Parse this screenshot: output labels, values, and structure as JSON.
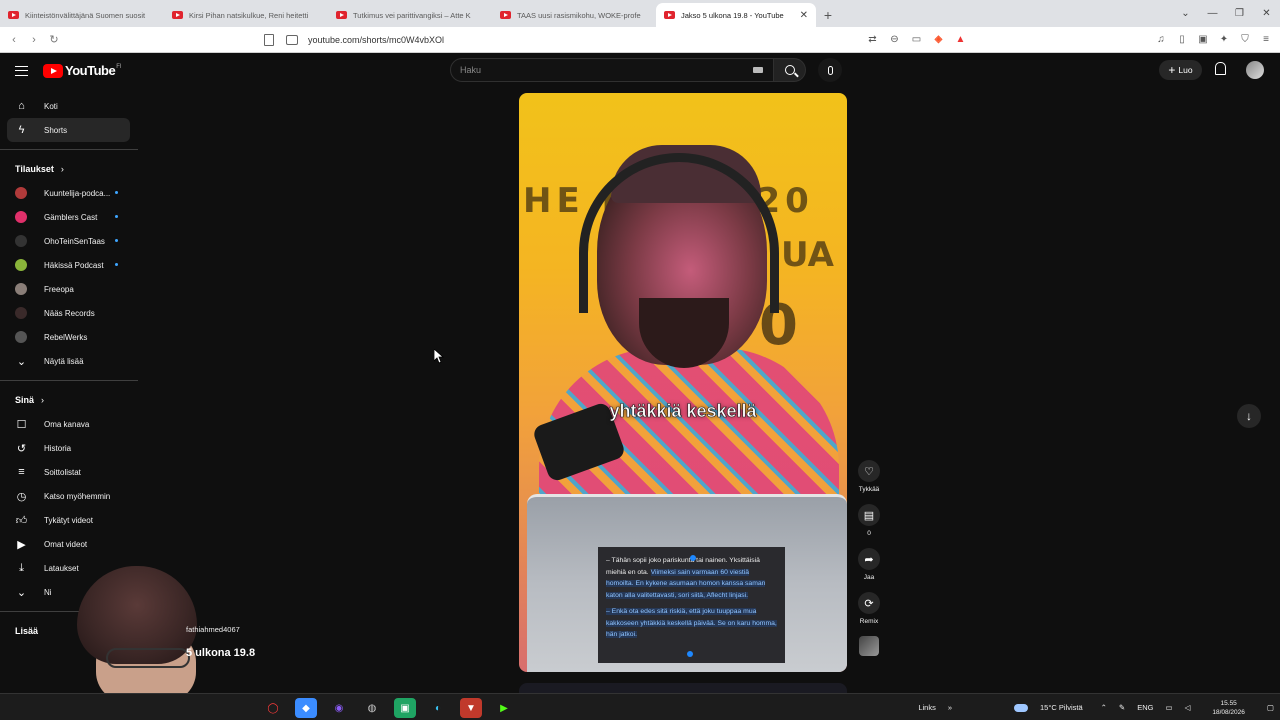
{
  "browser": {
    "tabs": [
      {
        "title": "Kiinteistönvälittäjänä Suomen suosit",
        "active": false
      },
      {
        "title": "Kirsi Pihan natsikulkue, Reni heitetti",
        "active": false
      },
      {
        "title": "Tutkimus vei parittivangiksi – Atte K",
        "active": false
      },
      {
        "title": "TAAS uusi rasismikohu, WOKE-profe",
        "active": false
      },
      {
        "title": "Jakso 5 ulkona 19.8 - YouTube",
        "active": true
      }
    ],
    "new_tab": "+",
    "url": "youtube.com/shorts/mc0W4vbXOl"
  },
  "header": {
    "logo_text": "YouTube",
    "logo_country": "FI",
    "search_placeholder": "Haku",
    "create_label": "Luo"
  },
  "sidebar": {
    "main": [
      {
        "label": "Koti",
        "icon": "home-icon"
      },
      {
        "label": "Shorts",
        "icon": "shorts-icon",
        "selected": true
      }
    ],
    "subs_title": "Tilaukset",
    "subscriptions": [
      {
        "label": "Kuuntelija-podca...",
        "color": "#b03a3a"
      },
      {
        "label": "Gämblers Cast",
        "color": "#e0306a"
      },
      {
        "label": "OhoTeinSenTaas",
        "color": "#333333"
      },
      {
        "label": "Häkissä Podcast",
        "color": "#8ab43a"
      },
      {
        "label": "Freeopa",
        "color": "#8a7e78"
      },
      {
        "label": "Nääs Records",
        "color": "#3a2a2a"
      },
      {
        "label": "RebelWerks",
        "color": "#555555"
      }
    ],
    "show_more": "Näytä lisää",
    "you_title": "Sinä",
    "you_items": [
      {
        "label": "Oma kanava",
        "icon": "person-icon"
      },
      {
        "label": "Historia",
        "icon": "history-icon"
      },
      {
        "label": "Soittolistat",
        "icon": "playlist-icon"
      },
      {
        "label": "Katso myöhemmin",
        "icon": "clock-icon"
      },
      {
        "label": "Tykätyt videot",
        "icon": "thumbs-up-icon"
      },
      {
        "label": "Omat videot",
        "icon": "video-icon"
      },
      {
        "label": "Lataukset",
        "icon": "download-icon"
      },
      {
        "label": "Ni",
        "icon": "chevron-down-icon"
      }
    ],
    "more_title": "Lisää"
  },
  "short": {
    "caption": "yhtäkkiä keskellä",
    "phone_text_1": "– Tähän sopii joko pariskunta tai nainen. Yksittäisiä miehiä en ota.",
    "phone_text_1_hl": "Viimeksi sain varmaan 60 viestiä homoilta. En kykene asumaan homon kanssa saman katon alla valitettavasti, sori siitä, Aflecht linjasi.",
    "phone_text_2_hl": "– Enkä ota edes sitä riskiä, että joku tuuppaa mua kakkoseen yhtäkkiä keskellä päivää. Se on karu homma, hän jatkoi."
  },
  "actions": [
    {
      "label": "Tykkää",
      "icon": "heart-icon"
    },
    {
      "label": "0",
      "icon": "comment-icon"
    },
    {
      "label": "Jaa",
      "icon": "share-icon"
    },
    {
      "label": "Remix",
      "icon": "remix-icon"
    }
  ],
  "overlay": {
    "handle": "fathiahmed4067",
    "title": "5 ulkona 19.8"
  },
  "taskbar": {
    "links": "Links",
    "weather": "15°C  Pilvistä",
    "lang": "ENG",
    "time": "15.55",
    "date": "18/08/2026"
  }
}
